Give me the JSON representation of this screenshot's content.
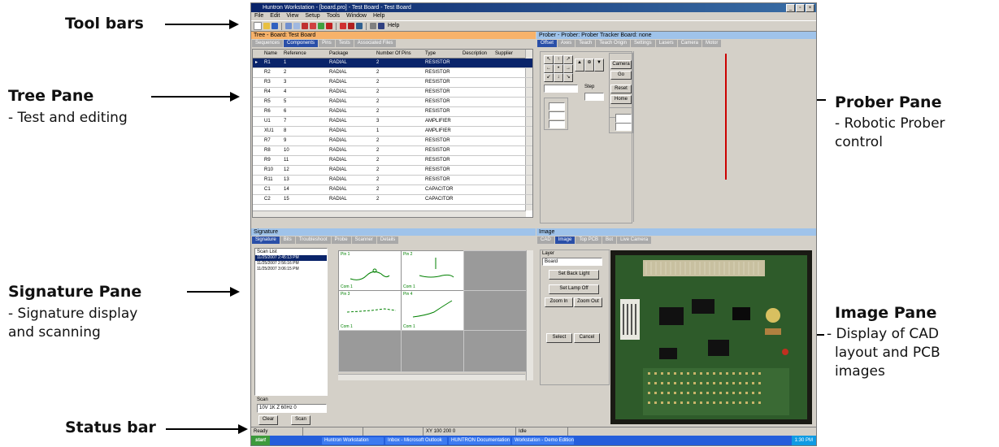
{
  "annotations": {
    "toolbars": {
      "title": "Tool bars"
    },
    "tree": {
      "title": "Tree Pane",
      "desc": "- Test and editing"
    },
    "signature": {
      "title": "Signature Pane",
      "desc1": "- Signature display",
      "desc2": "and scanning"
    },
    "status": {
      "title": "Status bar"
    },
    "prober": {
      "title": "Prober Pane",
      "desc1": "- Robotic Prober",
      "desc2": "control"
    },
    "image": {
      "title": "Image Pane",
      "desc1": "- Display of CAD",
      "desc2": "layout and PCB",
      "desc3": "images"
    }
  },
  "window": {
    "title": "Huntron Workstation - [board.pro] - Test Board - Test Board"
  },
  "menu": [
    "File",
    "Edit",
    "View",
    "Setup",
    "Tools",
    "Window",
    "Help"
  ],
  "toolbar": {
    "help_label": "Help"
  },
  "tree_pane": {
    "header": "Tree - Board: Test Board",
    "tabs": [
      "Sequences",
      "Components",
      "Pins",
      "Tests",
      "Associated Files"
    ],
    "columns": [
      "Name",
      "Reference",
      "Package",
      "Number Of Pins",
      "Type",
      "Description",
      "Supplier"
    ],
    "rows": [
      [
        "R1",
        "1",
        "RADIAL",
        "2",
        "RESISTOR"
      ],
      [
        "R2",
        "2",
        "RADIAL",
        "2",
        "RESISTOR"
      ],
      [
        "R3",
        "3",
        "RADIAL",
        "2",
        "RESISTOR"
      ],
      [
        "R4",
        "4",
        "RADIAL",
        "2",
        "RESISTOR"
      ],
      [
        "R5",
        "5",
        "RADIAL",
        "2",
        "RESISTOR"
      ],
      [
        "R6",
        "6",
        "RADIAL",
        "2",
        "RESISTOR"
      ],
      [
        "U1",
        "7",
        "RADIAL",
        "3",
        "AMPLIFIER"
      ],
      [
        "XU1",
        "8",
        "RADIAL",
        "1",
        "AMPLIFIER"
      ],
      [
        "R7",
        "9",
        "RADIAL",
        "2",
        "RESISTOR"
      ],
      [
        "R8",
        "10",
        "RADIAL",
        "2",
        "RESISTOR"
      ],
      [
        "R9",
        "11",
        "RADIAL",
        "2",
        "RESISTOR"
      ],
      [
        "R10",
        "12",
        "RADIAL",
        "2",
        "RESISTOR"
      ],
      [
        "R11",
        "13",
        "RADIAL",
        "2",
        "RESISTOR"
      ],
      [
        "C1",
        "14",
        "RADIAL",
        "2",
        "CAPACITOR"
      ],
      [
        "C2",
        "15",
        "RADIAL",
        "2",
        "CAPACITOR"
      ]
    ]
  },
  "prober_pane": {
    "header": "Prober - Prober: Prober Tracker Board: none",
    "tabs": [
      "Offset",
      "Axes",
      "Teach",
      "Teach Origin",
      "Settings",
      "Lasers",
      "Camera",
      "Motor"
    ],
    "step_label": "Step",
    "buttons": [
      "Camera",
      "Go",
      "Reset",
      "Home"
    ]
  },
  "signature_pane": {
    "header": "Signature",
    "tabs": [
      "Signature",
      "Bits",
      "Troubleshoot",
      "Probe",
      "Scanner",
      "Details"
    ],
    "scan_list_label": "Scan List",
    "scans": [
      "11/25/2007 2:45:13 PM",
      "11/25/2007 2:56:16 PM",
      "11/25/2007 3:06:15 PM"
    ],
    "signals": [
      {
        "label": "Pin 1",
        "foot": "Com 1"
      },
      {
        "label": "Pin 2",
        "foot": "Com 1"
      },
      {
        "label": "Pin 3",
        "foot": "Com 1"
      },
      {
        "label": "Pin 4",
        "foot": "Com 1"
      }
    ],
    "scan_label": "Scan",
    "scan_settings": "10V  1K  Z  60Hz  0",
    "buttons": {
      "clear": "Clear",
      "scan": "Scan"
    }
  },
  "image_pane": {
    "header": "Image",
    "tabs": [
      "CAD",
      "Image",
      "Top PCB",
      "Bot",
      "Live Camera"
    ],
    "layer_label": "Layer",
    "layer_value": "Board",
    "buttons": [
      "Set Back Light",
      "Set Lamp Off",
      "Zoom In",
      "Zoom Out",
      "Select",
      "Cancel"
    ]
  },
  "statusbar": {
    "fields": [
      "Ready",
      "",
      "",
      "XY 100 200 0",
      "Idle"
    ]
  },
  "taskbar": {
    "start": "start",
    "items": [
      "Huntron Workstation",
      "Inbox - Microsoft Outlook",
      "HUNTRON Documentation",
      "Workstation - Demo Edition"
    ],
    "clock": "1:30 PM"
  },
  "colors": {
    "pane_header": "#f7b26a",
    "active_tab": "#2a4fa8",
    "selection": "#0a246a",
    "probe_laser": "#cc0000"
  }
}
